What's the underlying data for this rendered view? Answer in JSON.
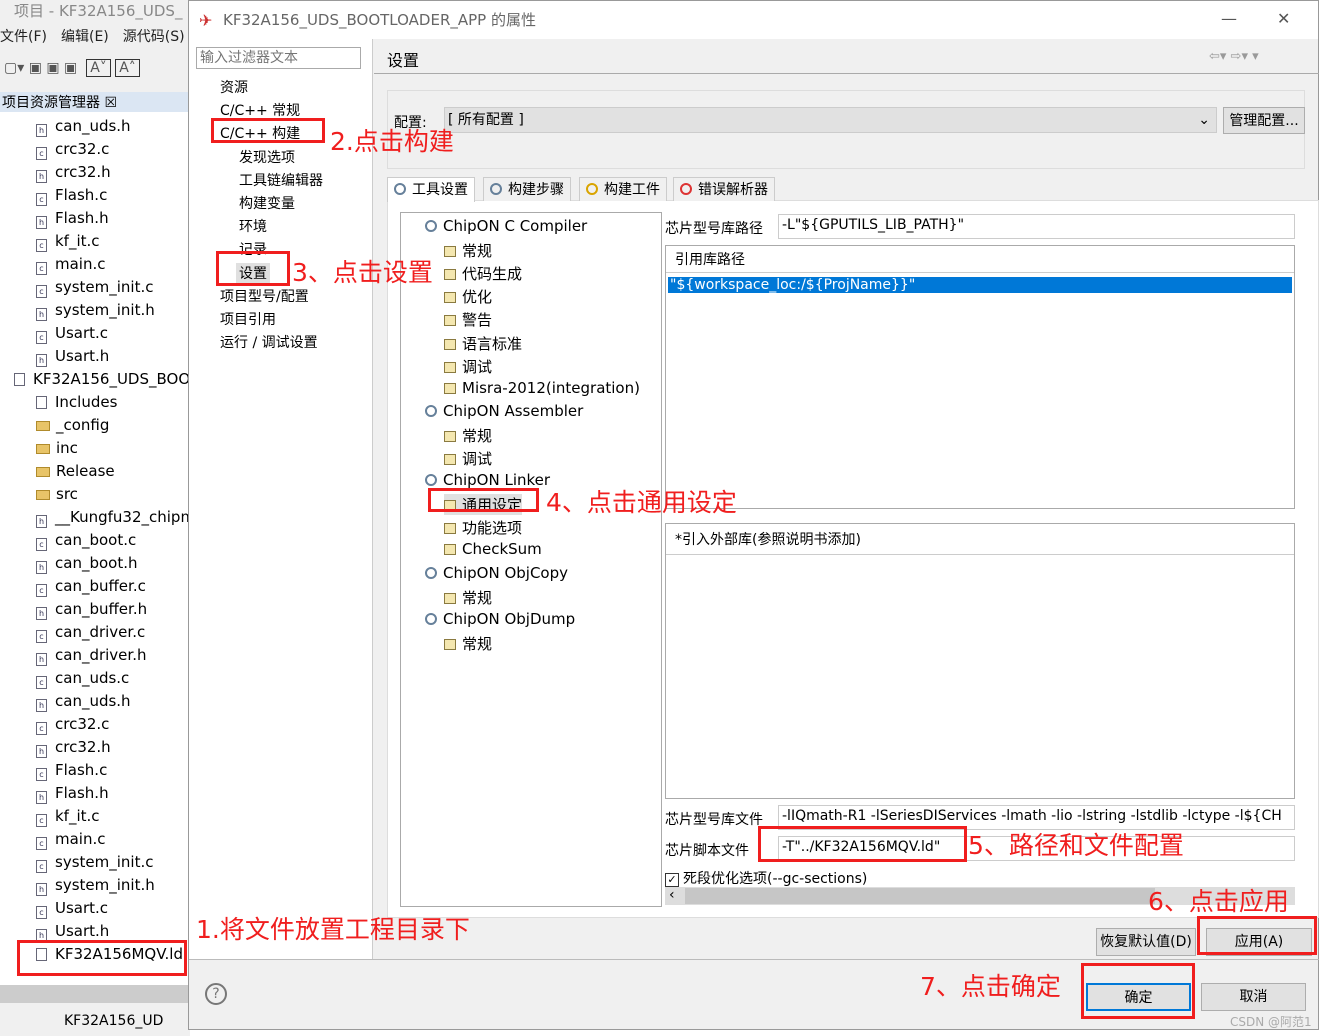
{
  "ide": {
    "title": "项目 - KF32A156_UDS_",
    "menu": [
      "文件(F)",
      "编辑(E)",
      "源代码(S)"
    ],
    "explorer_title": "项目资源管理器 ☒",
    "files": [
      {
        "n": "can_uds.h",
        "d": 2,
        "t": "h"
      },
      {
        "n": "crc32.c",
        "d": 2,
        "t": "c"
      },
      {
        "n": "crc32.h",
        "d": 2,
        "t": "h"
      },
      {
        "n": "Flash.c",
        "d": 2,
        "t": "c"
      },
      {
        "n": "Flash.h",
        "d": 2,
        "t": "h"
      },
      {
        "n": "kf_it.c",
        "d": 2,
        "t": "c"
      },
      {
        "n": "main.c",
        "d": 2,
        "t": "c"
      },
      {
        "n": "system_init.c",
        "d": 2,
        "t": "c"
      },
      {
        "n": "system_init.h",
        "d": 2,
        "t": "h"
      },
      {
        "n": "Usart.c",
        "d": 2,
        "t": "c"
      },
      {
        "n": "Usart.h",
        "d": 2,
        "t": "h"
      },
      {
        "n": "KF32A156_UDS_BOO",
        "d": 0,
        "t": "p"
      },
      {
        "n": "Includes",
        "d": 1,
        "t": "i"
      },
      {
        "n": "_config",
        "d": 1,
        "t": "f"
      },
      {
        "n": "inc",
        "d": 1,
        "t": "f"
      },
      {
        "n": "Release",
        "d": 1,
        "t": "f"
      },
      {
        "n": "src",
        "d": 1,
        "t": "f"
      },
      {
        "n": "__Kungfu32_chipm",
        "d": 1,
        "t": "h"
      },
      {
        "n": "can_boot.c",
        "d": 1,
        "t": "c"
      },
      {
        "n": "can_boot.h",
        "d": 1,
        "t": "h"
      },
      {
        "n": "can_buffer.c",
        "d": 1,
        "t": "c"
      },
      {
        "n": "can_buffer.h",
        "d": 1,
        "t": "h"
      },
      {
        "n": "can_driver.c",
        "d": 1,
        "t": "c"
      },
      {
        "n": "can_driver.h",
        "d": 1,
        "t": "h"
      },
      {
        "n": "can_uds.c",
        "d": 1,
        "t": "c"
      },
      {
        "n": "can_uds.h",
        "d": 1,
        "t": "h"
      },
      {
        "n": "crc32.c",
        "d": 1,
        "t": "c"
      },
      {
        "n": "crc32.h",
        "d": 1,
        "t": "h"
      },
      {
        "n": "Flash.c",
        "d": 1,
        "t": "c"
      },
      {
        "n": "Flash.h",
        "d": 1,
        "t": "h"
      },
      {
        "n": "kf_it.c",
        "d": 1,
        "t": "c"
      },
      {
        "n": "main.c",
        "d": 1,
        "t": "c"
      },
      {
        "n": "system_init.c",
        "d": 1,
        "t": "c"
      },
      {
        "n": "system_init.h",
        "d": 1,
        "t": "h"
      },
      {
        "n": "Usart.c",
        "d": 1,
        "t": "c"
      },
      {
        "n": "Usart.h",
        "d": 1,
        "t": "h"
      },
      {
        "n": "KF32A156MQV.ld",
        "d": 1,
        "t": "l"
      }
    ],
    "status": "KF32A156_UD"
  },
  "dialog": {
    "title": "KF32A156_UDS_BOOTLOADER_APP 的属性",
    "filter_placeholder": "输入过滤器文本",
    "nav": [
      {
        "l": "资源",
        "d": 0
      },
      {
        "l": "C/C++ 常规",
        "d": 0
      },
      {
        "l": "C/C++ 构建",
        "d": 0
      },
      {
        "l": "发现选项",
        "d": 1
      },
      {
        "l": "工具链编辑器",
        "d": 1
      },
      {
        "l": "构建变量",
        "d": 1
      },
      {
        "l": "环境",
        "d": 1
      },
      {
        "l": "记录",
        "d": 1
      },
      {
        "l": "设置",
        "d": 1
      },
      {
        "l": "项目型号/配置",
        "d": 0
      },
      {
        "l": "项目引用",
        "d": 0
      },
      {
        "l": "运行 / 调试设置",
        "d": 0
      }
    ],
    "section_title": "设置",
    "config_label": "配置:",
    "config_value": "[ 所有配置 ]",
    "manage_button": "管理配置...",
    "tabs": [
      "工具设置",
      "构建步骤",
      "构建工件",
      "错误解析器"
    ],
    "tool_tree": [
      {
        "l": "ChipON C Compiler",
        "d": 0
      },
      {
        "l": "常规",
        "d": 1
      },
      {
        "l": "代码生成",
        "d": 1
      },
      {
        "l": "优化",
        "d": 1
      },
      {
        "l": "警告",
        "d": 1
      },
      {
        "l": "语言标准",
        "d": 1
      },
      {
        "l": "调试",
        "d": 1
      },
      {
        "l": "Misra-2012(integration)",
        "d": 1
      },
      {
        "l": "ChipON Assembler",
        "d": 0
      },
      {
        "l": "常规",
        "d": 1
      },
      {
        "l": "调试",
        "d": 1
      },
      {
        "l": "ChipON Linker",
        "d": 0
      },
      {
        "l": "通用设定",
        "d": 1
      },
      {
        "l": "功能选项",
        "d": 1
      },
      {
        "l": "CheckSum",
        "d": 1
      },
      {
        "l": "ChipON ObjCopy",
        "d": 0
      },
      {
        "l": "常规",
        "d": 1
      },
      {
        "l": "ChipON ObjDump",
        "d": 0
      },
      {
        "l": "常规",
        "d": 1
      }
    ],
    "lib_path_label": "芯片型号库路径",
    "lib_path_value": "-L\"${GPUTILS_LIB_PATH}\"",
    "ref_lib_header": "引用库路径",
    "ref_lib_item": "\"${workspace_loc:/${ProjName}}\"",
    "ext_lib_header": "*引入外部库(参照说明书添加)",
    "lib_file_label": "芯片型号库文件",
    "lib_file_value": "-lIQmath-R1 -lSeriesDIServices -lmath -lio -lstring -lstdlib -lctype -l${CH",
    "script_label": "芯片脚本文件",
    "script_value": "-T\"../KF32A156MQV.ld\"",
    "gc_label": "死段优化选项(--gc-sections)",
    "gc_checked": true,
    "restore_button": "恢复默认值(D)",
    "apply_button": "应用(A)",
    "ok_button": "确定",
    "cancel_button": "取消"
  },
  "annotations": [
    "1.将文件放置工程目录下",
    "2.点击构建",
    "3、点击设置",
    "4、点击通用设定",
    "5、路径和文件配置",
    "6、点击应用",
    "7、点击确定"
  ],
  "watermark": "CSDN @阿范1",
  "colors": {
    "annotation": "#f01e1e",
    "selection": "#0078d7"
  }
}
